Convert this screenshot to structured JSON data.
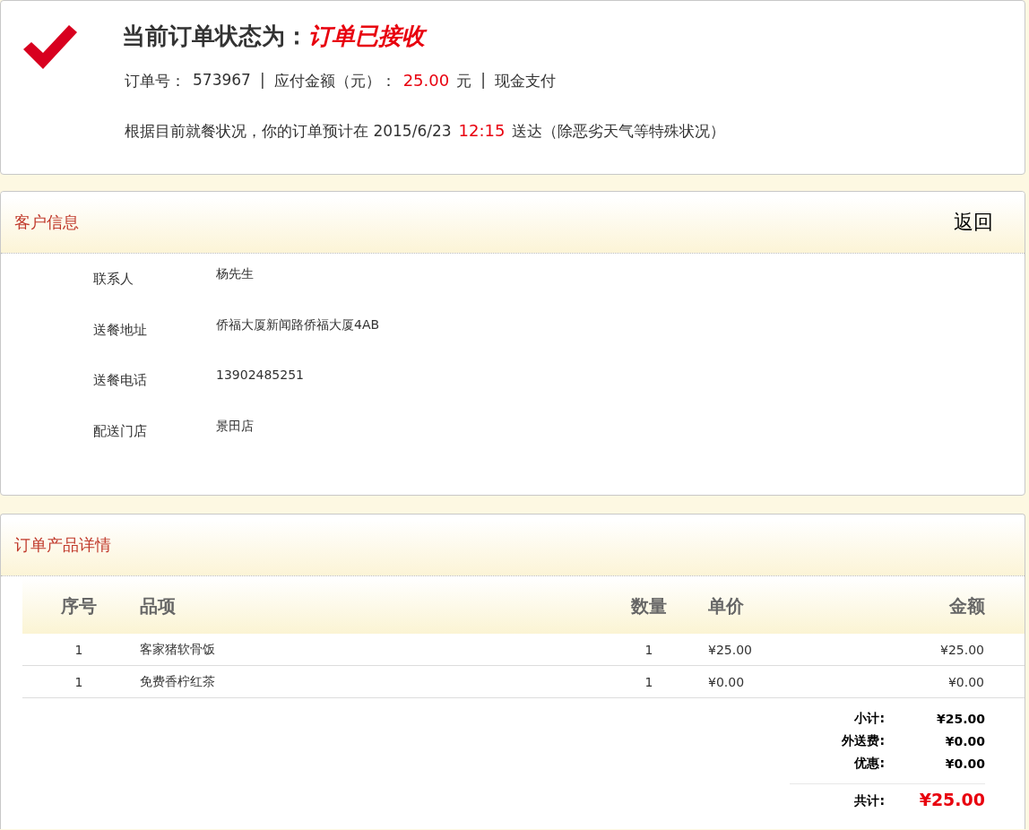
{
  "status": {
    "title": "当前订单状态为：",
    "status_text": "订单已接收",
    "order_line": [
      {
        "kind": "label",
        "text": "订单号："
      },
      {
        "kind": "value",
        "text": "573967"
      },
      {
        "kind": "separator",
        "text": "|"
      },
      {
        "kind": "label",
        "text": "应付金额（元）："
      },
      {
        "kind": "highlight",
        "text": "25.00"
      },
      {
        "kind": "value",
        "text": "元"
      },
      {
        "kind": "separator",
        "text": "|"
      },
      {
        "kind": "value",
        "text": "现金支付"
      }
    ],
    "delivery_line": [
      {
        "kind": "value",
        "text": "根据目前就餐状况，你的订单预计在 2015/6/23"
      },
      {
        "kind": "highlight",
        "text": "12:15"
      },
      {
        "kind": "value",
        "text": "送达（除恶劣天气等特殊状况）"
      }
    ]
  },
  "customer": {
    "title": "客户信息",
    "back_link": "返回",
    "fields": [
      {
        "label": "联系人",
        "value": "杨先生"
      },
      {
        "label": "送餐地址",
        "value": "侨福大厦新闻路侨福大厦4AB"
      },
      {
        "label": "送餐电话",
        "value": "13902485251"
      },
      {
        "label": "配送门店",
        "value": "景田店"
      }
    ]
  },
  "products": {
    "title": "订单产品详情",
    "columns": [
      "序号",
      "品项",
      "数量",
      "单价",
      "金额"
    ],
    "rows": [
      [
        "1",
        "客家猪软骨饭",
        "1",
        "¥25.00",
        "¥25.00"
      ],
      [
        "1",
        "免费香柠红茶",
        "1",
        "¥0.00",
        "¥0.00"
      ]
    ],
    "totals": [
      {
        "kind": "normal",
        "label": "小计:",
        "value": "¥25.00"
      },
      {
        "kind": "normal",
        "label": "外送费:",
        "value": "¥0.00"
      },
      {
        "kind": "normal",
        "label": "优惠:",
        "value": "¥0.00"
      },
      {
        "kind": "grand",
        "label": "共计:",
        "value": "¥25.00"
      }
    ]
  }
}
